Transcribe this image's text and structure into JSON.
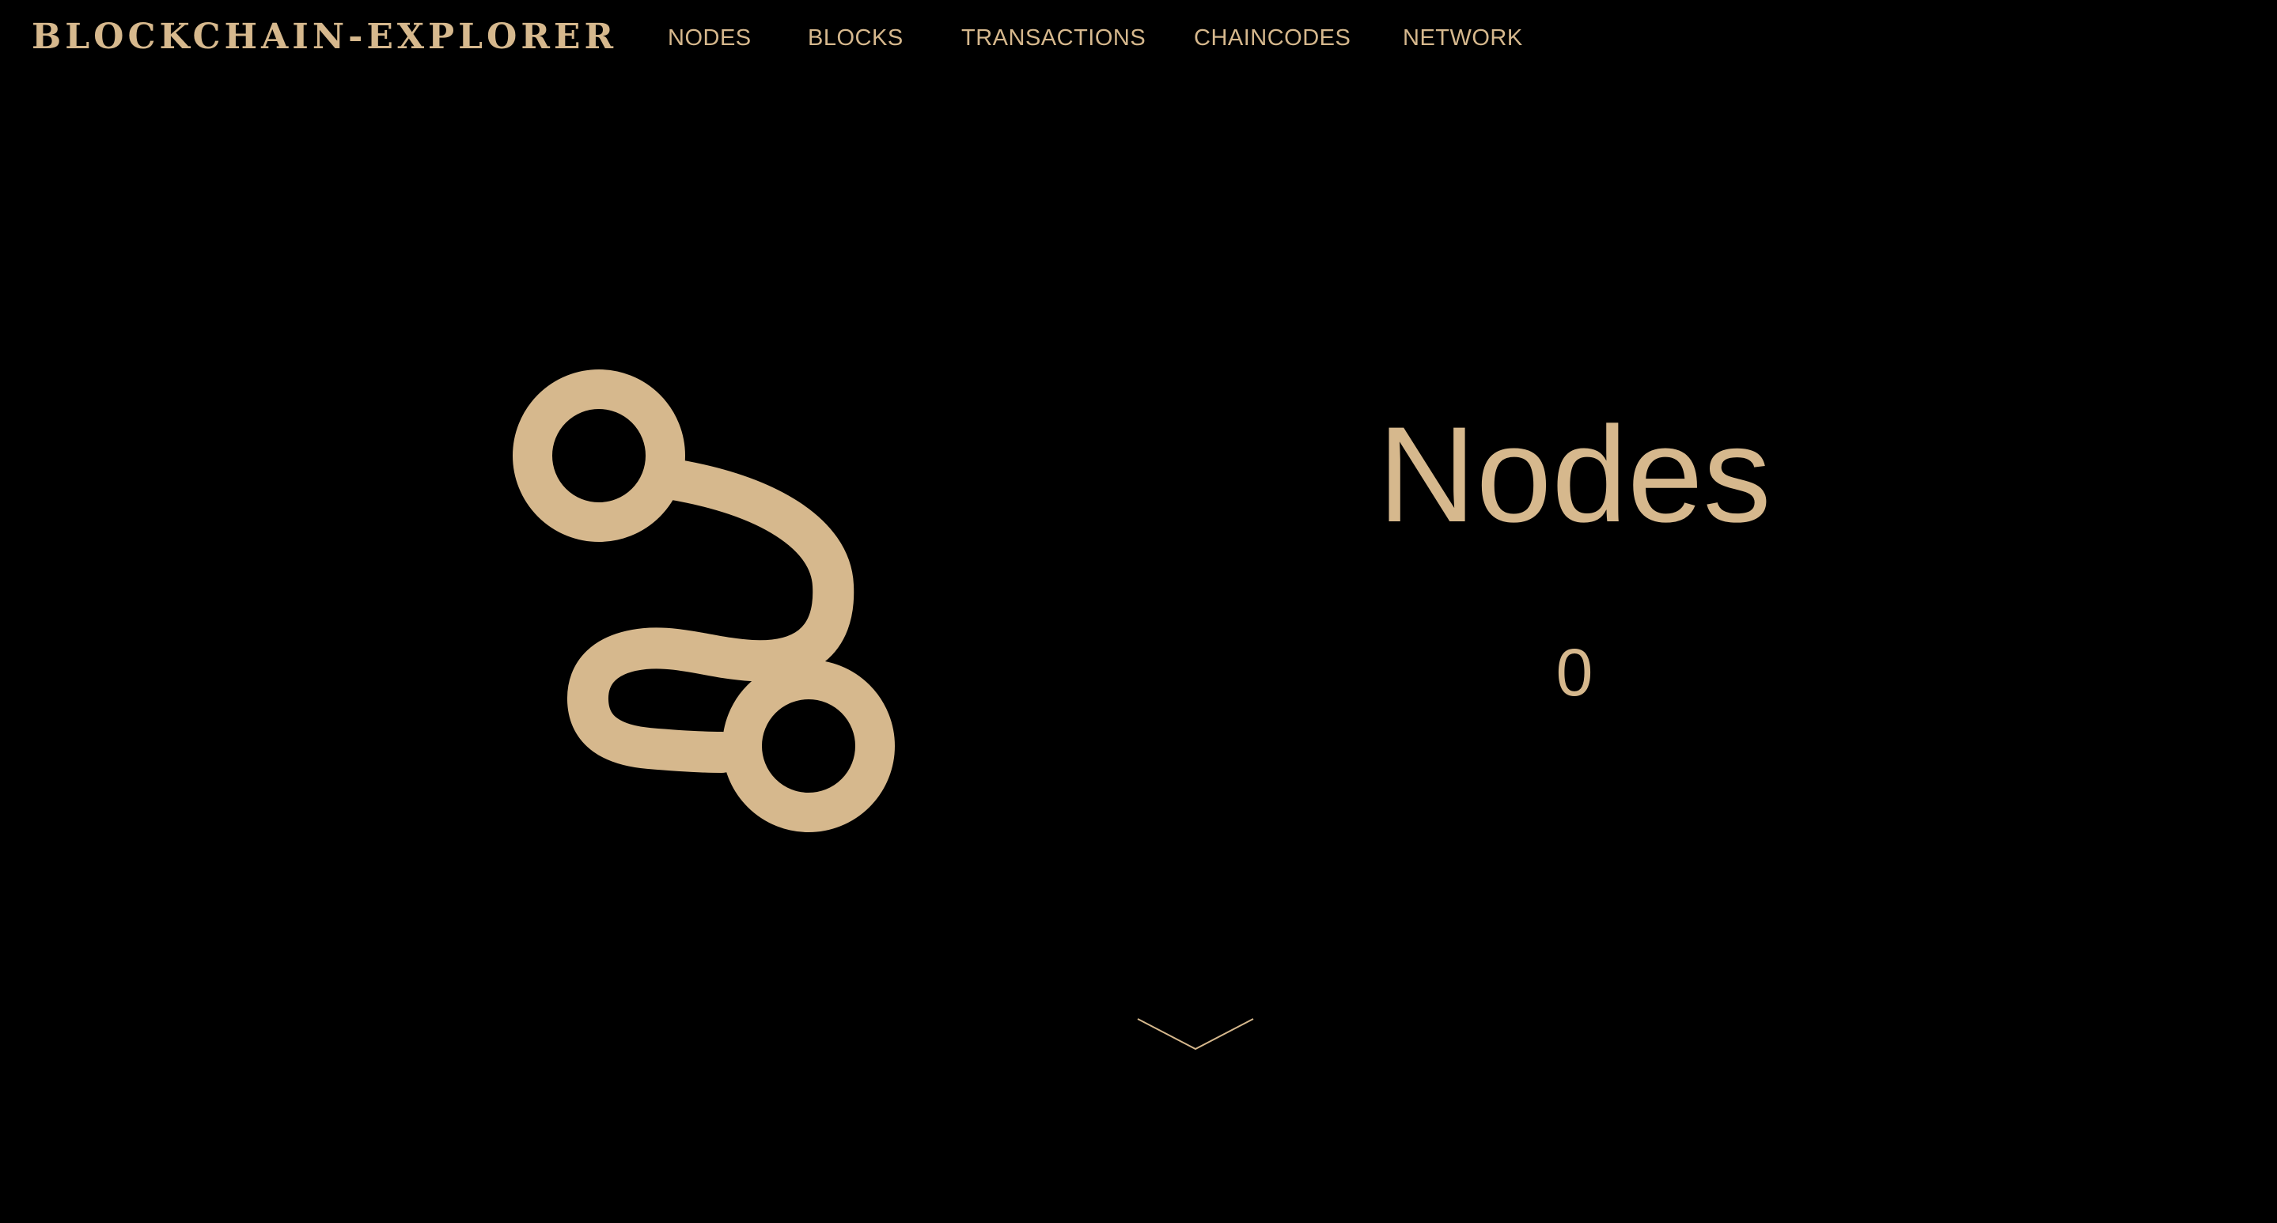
{
  "brand": {
    "name": "BLOCKCHAIN-EXPLORER"
  },
  "nav": {
    "items": [
      {
        "label": "NODES"
      },
      {
        "label": "BLOCKS"
      },
      {
        "label": "TRANSACTIONS"
      },
      {
        "label": "CHAINCODES"
      },
      {
        "label": "NETWORK"
      }
    ]
  },
  "hero": {
    "icon": "route-icon",
    "title": "Nodes",
    "count": "0"
  },
  "scroll": {
    "icon": "chevron-down-icon"
  },
  "colors": {
    "background": "#000000",
    "accent": "#d6b88d"
  }
}
